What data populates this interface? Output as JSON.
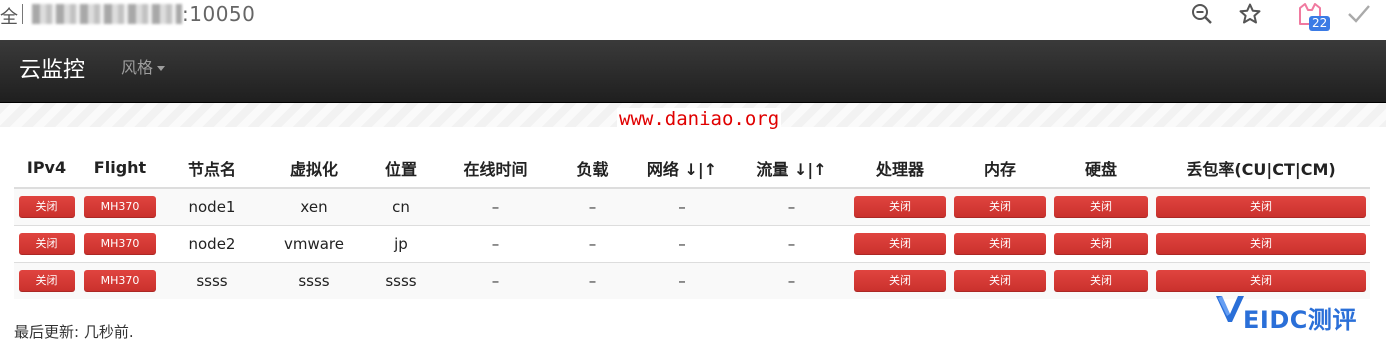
{
  "browser": {
    "left_text": "全",
    "address_port": ":10050",
    "badge_count": "22"
  },
  "navbar": {
    "brand": "云监控",
    "style_menu": "风格"
  },
  "watermark": "www.daniao.org",
  "table": {
    "headers": [
      "IPv4",
      "Flight",
      "节点名",
      "虚拟化",
      "位置",
      "在线时间",
      "负载",
      "网络 ↓|↑",
      "流量 ↓|↑",
      "处理器",
      "内存",
      "硬盘",
      "丢包率(CU|CT|CM)"
    ],
    "rows": [
      {
        "ipv4": "关闭",
        "flight": "MH370",
        "name": "node1",
        "virt": "xen",
        "loc": "cn",
        "uptime": "–",
        "load": "–",
        "net": "–",
        "traffic": "–",
        "cpu": "关闭",
        "mem": "关闭",
        "disk": "关闭",
        "loss": "关闭"
      },
      {
        "ipv4": "关闭",
        "flight": "MH370",
        "name": "node2",
        "virt": "vmware",
        "loc": "jp",
        "uptime": "–",
        "load": "–",
        "net": "–",
        "traffic": "–",
        "cpu": "关闭",
        "mem": "关闭",
        "disk": "关闭",
        "loss": "关闭"
      },
      {
        "ipv4": "关闭",
        "flight": "MH370",
        "name": "ssss",
        "virt": "ssss",
        "loc": "ssss",
        "uptime": "–",
        "load": "–",
        "net": "–",
        "traffic": "–",
        "cpu": "关闭",
        "mem": "关闭",
        "disk": "关闭",
        "loss": "关闭"
      }
    ]
  },
  "footer": "最后更新: 几秒前.",
  "logo": {
    "text": "EIDC测评",
    "color": "#2a6fd8"
  },
  "colors": {
    "danger": "#d9534f",
    "navbar": "#222222"
  },
  "icons": [
    "zoom-icon",
    "star-icon",
    "extension-cat-icon",
    "check-icon"
  ]
}
